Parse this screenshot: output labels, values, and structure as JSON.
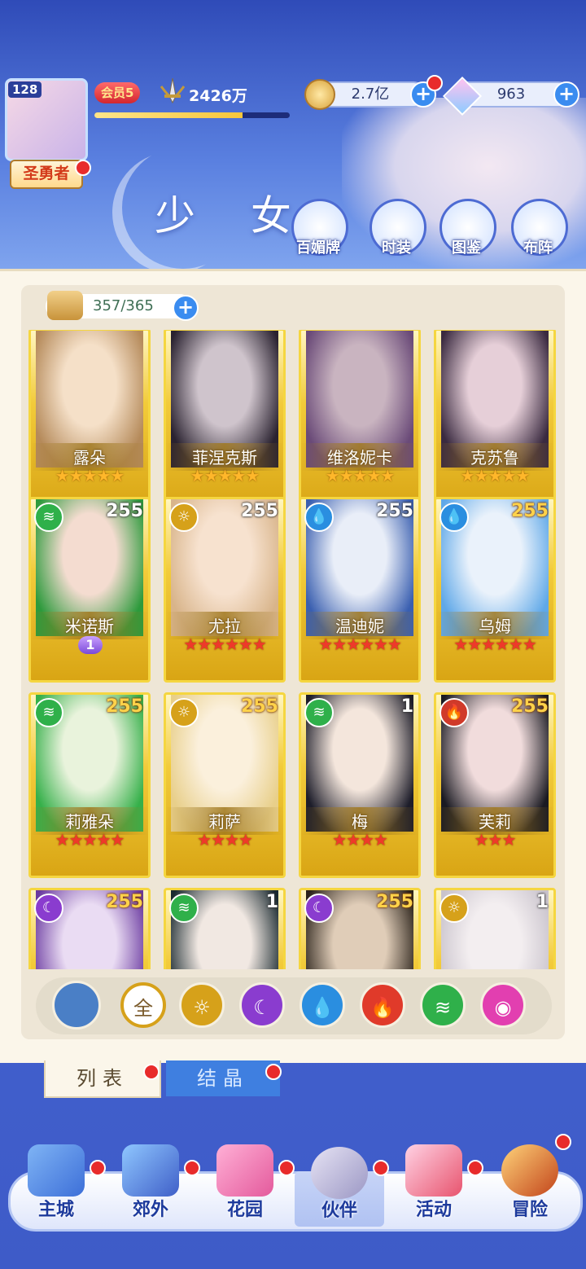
{
  "header": {
    "avatar_level": "128",
    "player_title": "圣勇者",
    "vip_label": "会员5",
    "power": "2426万",
    "exp_progress": 0.76,
    "gold": "2.7亿",
    "gems": "963"
  },
  "page_title": "少 女",
  "header_buttons": [
    {
      "label": "百媚牌",
      "icon": "card-deck-icon"
    },
    {
      "label": "时装",
      "icon": "costume-icon"
    },
    {
      "label": "图鉴",
      "icon": "codex-book-icon"
    },
    {
      "label": "布阵",
      "icon": "formation-grid-icon"
    }
  ],
  "collection_count": "357/365",
  "cards": [
    {
      "name": "露朵",
      "stars": "★★★★★",
      "star_color": "gold",
      "level": "",
      "element": "",
      "portrait": [
        "#f5e0c8",
        "#b58a5a"
      ]
    },
    {
      "name": "菲涅克斯",
      "stars": "★★★★★",
      "star_color": "gold",
      "level": "",
      "element": "",
      "portrait": [
        "#cfc4cc",
        "#2a2230"
      ]
    },
    {
      "name": "维洛妮卡",
      "stars": "★★★★★",
      "star_color": "gold",
      "level": "",
      "element": "",
      "portrait": [
        "#c9b4c0",
        "#6a4a78"
      ]
    },
    {
      "name": "克苏鲁",
      "stars": "★★★★★",
      "star_color": "gold",
      "level": "",
      "element": "",
      "portrait": [
        "#e6cfd8",
        "#3a2a40"
      ]
    },
    {
      "name": "米诺斯",
      "stars": "",
      "star_color": "gold",
      "level": "255",
      "level_color": "white",
      "element": "wind",
      "badge": "1",
      "portrait": [
        "#f4dcd0",
        "#2d9a3c"
      ]
    },
    {
      "name": "尤拉",
      "stars": "★★★★★★",
      "star_color": "red",
      "level": "255",
      "level_color": "white",
      "element": "light",
      "portrait": [
        "#f7e2cf",
        "#d8b48a"
      ]
    },
    {
      "name": "温迪妮",
      "stars": "★★★★★★",
      "star_color": "red",
      "level": "255",
      "level_color": "white",
      "element": "water",
      "portrait": [
        "#e9eef8",
        "#3a5fb0"
      ]
    },
    {
      "name": "乌姆",
      "stars": "★★★★★★",
      "star_color": "red",
      "level": "255",
      "level_color": "gold",
      "element": "water",
      "portrait": [
        "#eaf2fb",
        "#5fa8e8"
      ]
    },
    {
      "name": "莉雅朵",
      "stars": "★★★★★",
      "star_color": "red",
      "level": "255",
      "level_color": "gold",
      "element": "wind",
      "portrait": [
        "#e9f3dc",
        "#36b04a"
      ]
    },
    {
      "name": "莉萨",
      "stars": "★★★★",
      "star_color": "red",
      "level": "255",
      "level_color": "gold",
      "element": "light",
      "portrait": [
        "#fbf0dc",
        "#e8cf8a"
      ]
    },
    {
      "name": "梅",
      "stars": "★★★★",
      "star_color": "red",
      "level": "1",
      "level_color": "white",
      "element": "wind",
      "portrait": [
        "#f4e6dc",
        "#1d1d2a"
      ]
    },
    {
      "name": "芙莉",
      "stars": "★★★",
      "star_color": "red",
      "level": "255",
      "level_color": "gold",
      "element": "fire",
      "portrait": [
        "#f1dcdc",
        "#1a1a22"
      ]
    },
    {
      "name": "",
      "stars": "",
      "star_color": "red",
      "level": "255",
      "level_color": "gold",
      "element": "dark",
      "portrait": [
        "#eadcf3",
        "#6a3aa0"
      ]
    },
    {
      "name": "",
      "stars": "",
      "star_color": "red",
      "level": "1",
      "level_color": "white",
      "element": "wind",
      "portrait": [
        "#f1e8e2",
        "#1a2a30"
      ]
    },
    {
      "name": "",
      "stars": "",
      "star_color": "red",
      "level": "255",
      "level_color": "gold",
      "element": "dark",
      "portrait": [
        "#e0cdb8",
        "#2a221a"
      ]
    },
    {
      "name": "",
      "stars": "",
      "star_color": "red",
      "level": "1",
      "level_color": "white",
      "element": "light",
      "portrait": [
        "#f3eef0",
        "#c9c3cc"
      ]
    }
  ],
  "filters": [
    {
      "label": "",
      "name": "filter-up-icon",
      "color": "#4a7fc6"
    },
    {
      "label": "全",
      "name": "filter-all-button",
      "color": "#ffffff"
    },
    {
      "label": "☼",
      "name": "filter-light-icon",
      "color": "#d6a11a"
    },
    {
      "label": "☾",
      "name": "filter-dark-icon",
      "color": "#8a3ccf"
    },
    {
      "label": "💧",
      "name": "filter-water-icon",
      "color": "#2a8ee0"
    },
    {
      "label": "🔥",
      "name": "filter-fire-icon",
      "color": "#e03a2a"
    },
    {
      "label": "≋",
      "name": "filter-wind-icon",
      "color": "#2fb04a"
    },
    {
      "label": "◉",
      "name": "filter-psychic-icon",
      "color": "#e23fb0"
    }
  ],
  "tabs": {
    "list": "列表",
    "crystal": "结晶"
  },
  "nav": [
    {
      "label": "主城",
      "icon": "castle-icon"
    },
    {
      "label": "郊外",
      "icon": "outskirts-icon"
    },
    {
      "label": "花园",
      "icon": "garden-heart-icon"
    },
    {
      "label": "伙伴",
      "icon": "partner-icon"
    },
    {
      "label": "活动",
      "icon": "gift-box-icon"
    },
    {
      "label": "冒险",
      "icon": "adventure-compass-icon"
    }
  ]
}
